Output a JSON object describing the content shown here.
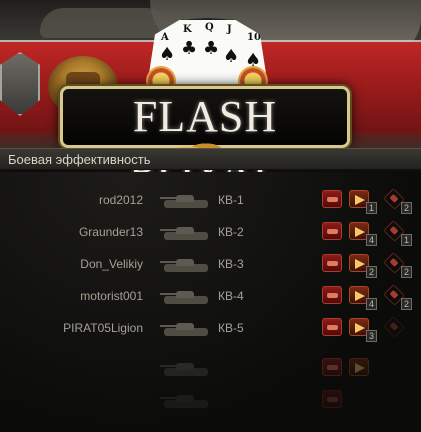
{
  "logo": {
    "title": "FLASH ROYAL",
    "cards": [
      {
        "rank": "A",
        "suit": "♠"
      },
      {
        "rank": "K",
        "suit": "♣"
      },
      {
        "rank": "Q",
        "suit": "♣"
      },
      {
        "rank": "J",
        "suit": "♠"
      },
      {
        "rank": "10",
        "suit": "♠"
      }
    ]
  },
  "section": {
    "title": "Боевая эффективность"
  },
  "rows": [
    {
      "player": "rod2012",
      "tank": "КВ-1",
      "spot_count": "1",
      "kill_count": "2"
    },
    {
      "player": "Graunder13",
      "tank": "КВ-2",
      "spot_count": "4",
      "kill_count": "1"
    },
    {
      "player": "Don_Velikiy",
      "tank": "КВ-3",
      "spot_count": "2",
      "kill_count": "2"
    },
    {
      "player": "motorist001",
      "tank": "КВ-4",
      "spot_count": "4",
      "kill_count": "2"
    },
    {
      "player": "PIRAT05Ligion",
      "tank": "КВ-5",
      "spot_count": "3",
      "kill_count": ""
    }
  ],
  "colors": {
    "accent": "#a42222",
    "gold": "#d9c88c"
  }
}
